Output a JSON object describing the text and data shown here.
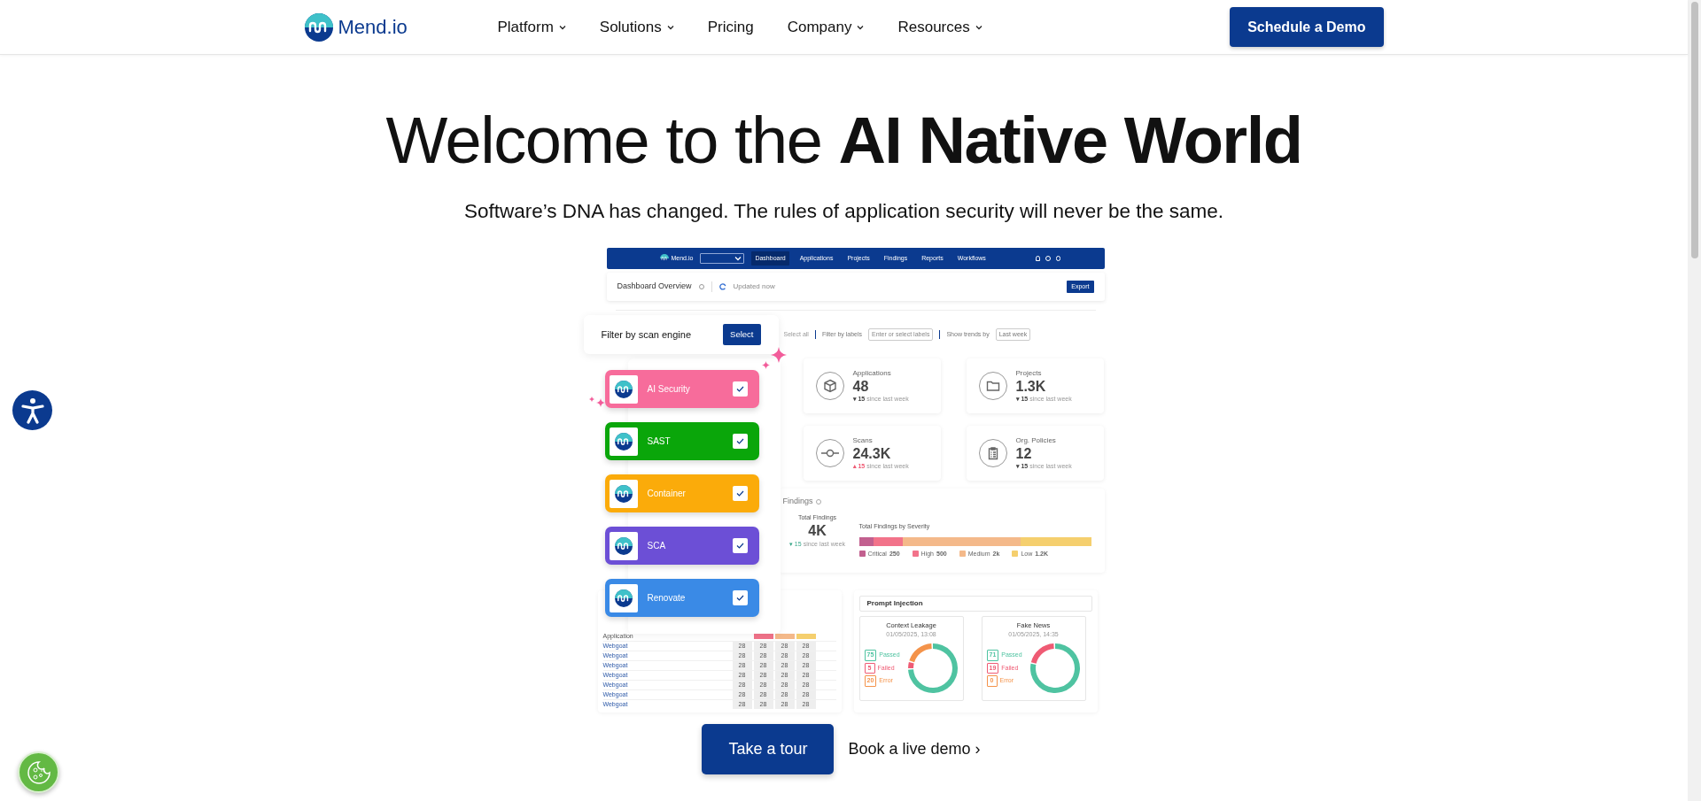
{
  "nav": {
    "logo": "Mend.io",
    "items": [
      {
        "label": "Platform",
        "dropdown": true
      },
      {
        "label": "Solutions",
        "dropdown": true
      },
      {
        "label": "Pricing",
        "dropdown": false
      },
      {
        "label": "Company",
        "dropdown": true
      },
      {
        "label": "Resources",
        "dropdown": true
      }
    ],
    "cta": "Schedule a Demo"
  },
  "hero": {
    "title": "Welcome to the **AI Native World**",
    "subtitle": "Software’s DNA has changed. The rules of application security will never be the same."
  },
  "dashboard": {
    "topbar": {
      "logo": "Mend.io",
      "items": [
        {
          "label": "Dashboard",
          "selected": true
        },
        {
          "label": "Applications",
          "selected": false
        },
        {
          "label": "Projects",
          "selected": false
        },
        {
          "label": "Findings",
          "selected": false
        },
        {
          "label": "Reports",
          "selected": false
        },
        {
          "label": "Workflows",
          "selected": false
        }
      ]
    },
    "overview": {
      "title": "Dashboard Overview",
      "status": "Updated now",
      "export": "Export"
    },
    "filters": {
      "select_all": "Select all",
      "labels_label": "Filter by labels",
      "labels_placeholder": "Enter or select labels",
      "trends_label": "Show trends by",
      "trends_value": "Last week"
    },
    "engine_filter": {
      "label": "Filter by scan engine",
      "button": "Select",
      "engines": [
        {
          "name": "AI Security",
          "color": "#f76c9b",
          "checked": true
        },
        {
          "name": "SAST",
          "color": "#0aa60a",
          "checked": true
        },
        {
          "name": "Container",
          "color": "#fbab0a",
          "checked": true
        },
        {
          "name": "SCA",
          "color": "#6c4fd6",
          "checked": true
        },
        {
          "name": "Renovate",
          "color": "#3a8ae6",
          "checked": true
        }
      ]
    },
    "stats": [
      {
        "kind": "cube",
        "title": "Applications",
        "value": "48",
        "delta": "▾ 15",
        "color": "#444444",
        "note": "since last week"
      },
      {
        "kind": "folder",
        "title": "Projects",
        "value": "1.3K",
        "delta": "▾ 15",
        "color": "#444444",
        "note": "since last week"
      },
      {
        "kind": "commit",
        "title": "Scans",
        "value": "24.3K",
        "delta": "▴ 15",
        "color": "#ef5b74",
        "note": "since last week"
      },
      {
        "kind": "clipboard",
        "title": "Org. Policies",
        "value": "12",
        "delta": "▾ 15",
        "color": "#444444",
        "note": "since last week"
      }
    ],
    "findings": {
      "title": "Findings",
      "total_label": "Total Findings",
      "total": "4K",
      "delta": "▾ 15",
      "note": "since last week",
      "severity_title": "Total Findings by Severity",
      "legend": [
        {
          "label": "Critical",
          "value": "250",
          "color": "#c2608f"
        },
        {
          "label": "High",
          "value": "500",
          "color": "#f2738a"
        },
        {
          "label": "Medium",
          "value": "2k",
          "color": "#f4b98a"
        },
        {
          "label": "Low",
          "value": "1.2K",
          "color": "#f5cf6e"
        }
      ]
    },
    "table": {
      "header": "Application",
      "rows": [
        {
          "name": "Webgoat",
          "cells": [
            "28",
            "28",
            "28",
            "28"
          ]
        },
        {
          "name": "Webgoat",
          "cells": [
            "28",
            "28",
            "28",
            "28"
          ]
        },
        {
          "name": "Webgoat",
          "cells": [
            "28",
            "28",
            "28",
            "28"
          ]
        },
        {
          "name": "Webgoat",
          "cells": [
            "28",
            "28",
            "28",
            "28"
          ]
        },
        {
          "name": "Webgoat",
          "cells": [
            "28",
            "28",
            "28",
            "28"
          ]
        },
        {
          "name": "Webgoat",
          "cells": [
            "28",
            "28",
            "28",
            "28"
          ]
        },
        {
          "name": "Webgoat",
          "cells": [
            "28",
            "28",
            "28",
            "28"
          ]
        }
      ]
    },
    "prompt_injection": {
      "title": "Prompt Injection",
      "tests": [
        {
          "name": "Context Leakage",
          "date": "01/05/2025, 13:08",
          "legend": [
            {
              "value": "75",
              "color": "#4fc3a1"
            },
            {
              "value": "5",
              "color": "#ef5b74"
            },
            {
              "value": "20",
              "color": "#f4934a"
            }
          ],
          "chart_data": {
            "type": "donut",
            "categories": [
              "Passed",
              "Failed",
              "Error"
            ],
            "values": [
              75,
              5,
              20
            ]
          }
        },
        {
          "name": "Fake News",
          "date": "01/05/2025, 14:35",
          "legend": [
            {
              "value": "71",
              "color": "#4fc3a1"
            },
            {
              "value": "19",
              "color": "#ef5b74"
            },
            {
              "value": "0",
              "color": "#f4934a"
            }
          ],
          "chart_data": {
            "type": "donut",
            "categories": [
              "Passed",
              "Failed",
              "Error"
            ],
            "values": [
              78.9,
              21.1,
              0
            ]
          }
        }
      ]
    }
  },
  "actions": {
    "primary": "Take a tour",
    "secondary": "Book a live demo ›"
  }
}
